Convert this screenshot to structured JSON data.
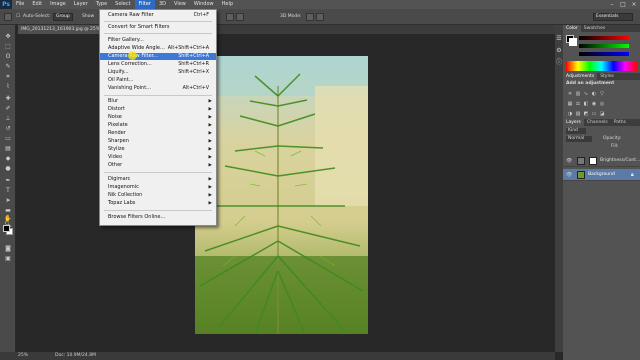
{
  "menubar": {
    "logo": "Ps",
    "items": [
      "File",
      "Edit",
      "Image",
      "Layer",
      "Type",
      "Select",
      "Filter",
      "3D",
      "View",
      "Window",
      "Help"
    ],
    "active_index": 6
  },
  "options": {
    "auto_select_label": "Auto-Select:",
    "auto_select_value": "Group",
    "show_label": "Show",
    "mode_label": "3D Mode:",
    "workspace": "Essentials"
  },
  "document": {
    "tab_label": "IMG_20131213_161903.jpg @ 25% (Backgr..."
  },
  "status": {
    "zoom": "25%",
    "doc_info": "Doc: 10.9M/24.8M"
  },
  "filter_menu": {
    "groups": [
      [
        {
          "label": "Camera Raw Filter",
          "shortcut": "Ctrl+F"
        }
      ],
      [
        {
          "label": "Convert for Smart Filters",
          "shortcut": ""
        }
      ],
      [
        {
          "label": "Filter Gallery...",
          "shortcut": ""
        },
        {
          "label": "Adaptive Wide Angle...",
          "shortcut": "Alt+Shift+Ctrl+A"
        },
        {
          "label": "Camera Raw Filter...",
          "shortcut": "Shift+Ctrl+A"
        },
        {
          "label": "Lens Correction...",
          "shortcut": "Shift+Ctrl+R"
        },
        {
          "label": "Liquify...",
          "shortcut": "Shift+Ctrl+X"
        },
        {
          "label": "Oil Paint...",
          "shortcut": ""
        },
        {
          "label": "Vanishing Point...",
          "shortcut": "Alt+Ctrl+V"
        }
      ],
      [
        {
          "label": "Blur",
          "shortcut": ""
        },
        {
          "label": "Distort",
          "shortcut": ""
        },
        {
          "label": "Noise",
          "shortcut": ""
        },
        {
          "label": "Pixelate",
          "shortcut": ""
        },
        {
          "label": "Render",
          "shortcut": ""
        },
        {
          "label": "Sharpen",
          "shortcut": ""
        },
        {
          "label": "Stylize",
          "shortcut": ""
        },
        {
          "label": "Video",
          "shortcut": ""
        },
        {
          "label": "Other",
          "shortcut": ""
        }
      ],
      [
        {
          "label": "Digimarc",
          "shortcut": ""
        },
        {
          "label": "Imagenomic",
          "shortcut": ""
        },
        {
          "label": "Nik Collection",
          "shortcut": ""
        },
        {
          "label": "Topaz Labs",
          "shortcut": ""
        }
      ],
      [
        {
          "label": "Browse Filters Online...",
          "shortcut": ""
        }
      ]
    ],
    "highlighted": "Camera Raw Filter..."
  },
  "panels": {
    "color_tabs": [
      "Color",
      "Swatches"
    ],
    "adjustments_tabs": [
      "Adjustments",
      "Styles"
    ],
    "adjustments_title": "Add an adjustment",
    "layers_tabs": [
      "Layers",
      "Channels",
      "Paths"
    ],
    "kind_label": "Kind",
    "blend_mode": "Normal",
    "opacity_label": "Opacity:",
    "fill_label": "Fill:",
    "layers": [
      {
        "name": "Brightness/Cont...",
        "selected": false
      },
      {
        "name": "Background",
        "selected": true
      }
    ]
  },
  "colors": {
    "accent_blue": "#3c78d8",
    "menubar": "#535353",
    "canvas_bg": "#282828"
  }
}
